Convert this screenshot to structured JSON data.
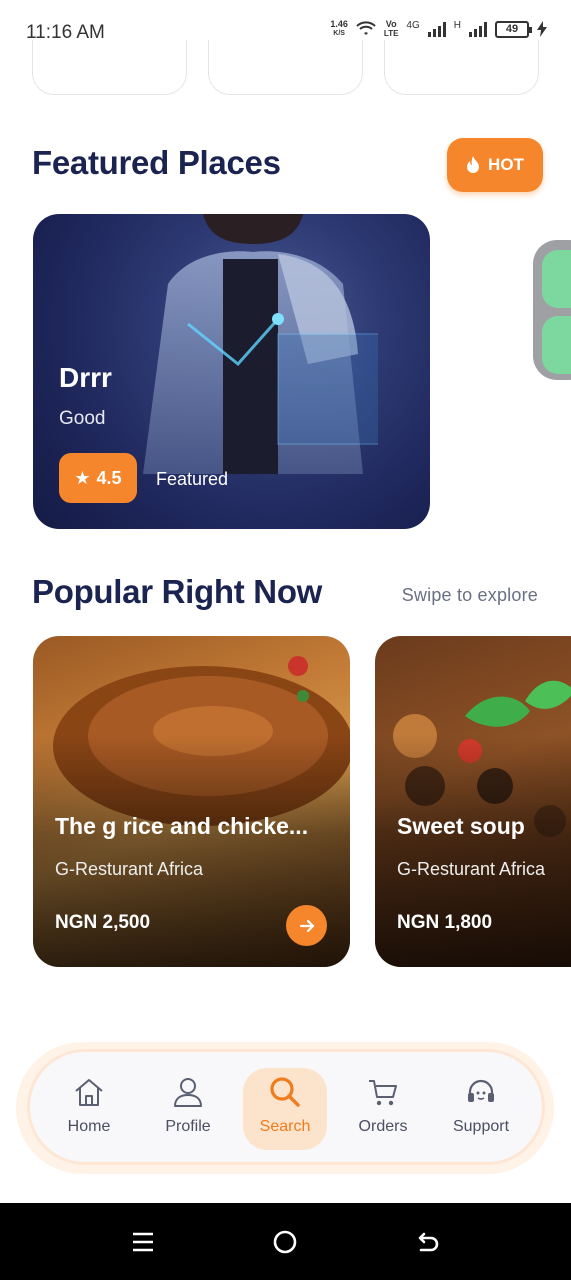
{
  "status_bar": {
    "time": "11:16 AM",
    "speed_value": "1.46",
    "speed_unit": "K/S",
    "volte_top": "Vo",
    "volte_bottom": "LTE",
    "network_4g": "4G",
    "network_h": "H",
    "battery": "49"
  },
  "featured": {
    "title": "Featured Places",
    "hot_label": "HOT",
    "card": {
      "name": "Drrr",
      "subtitle": "Good",
      "rating": "4.5",
      "tag": "Featured"
    }
  },
  "popular": {
    "title": "Popular Right Now",
    "hint": "Swipe to explore",
    "items": [
      {
        "name": "The g rice and chicke...",
        "restaurant": "G-Resturant Africa",
        "price": "NGN 2,500"
      },
      {
        "name": "Sweet soup",
        "restaurant": "G-Resturant Africa",
        "price": "NGN 1,800"
      }
    ]
  },
  "nav": {
    "items": [
      {
        "label": "Home",
        "icon": "home-icon"
      },
      {
        "label": "Profile",
        "icon": "user-icon"
      },
      {
        "label": "Search",
        "icon": "search-icon",
        "active": true
      },
      {
        "label": "Orders",
        "icon": "cart-icon"
      },
      {
        "label": "Support",
        "icon": "headset-icon"
      }
    ]
  },
  "colors": {
    "accent": "#f5862b",
    "heading": "#1b2350",
    "nav_active_bg": "#fce3cc"
  }
}
